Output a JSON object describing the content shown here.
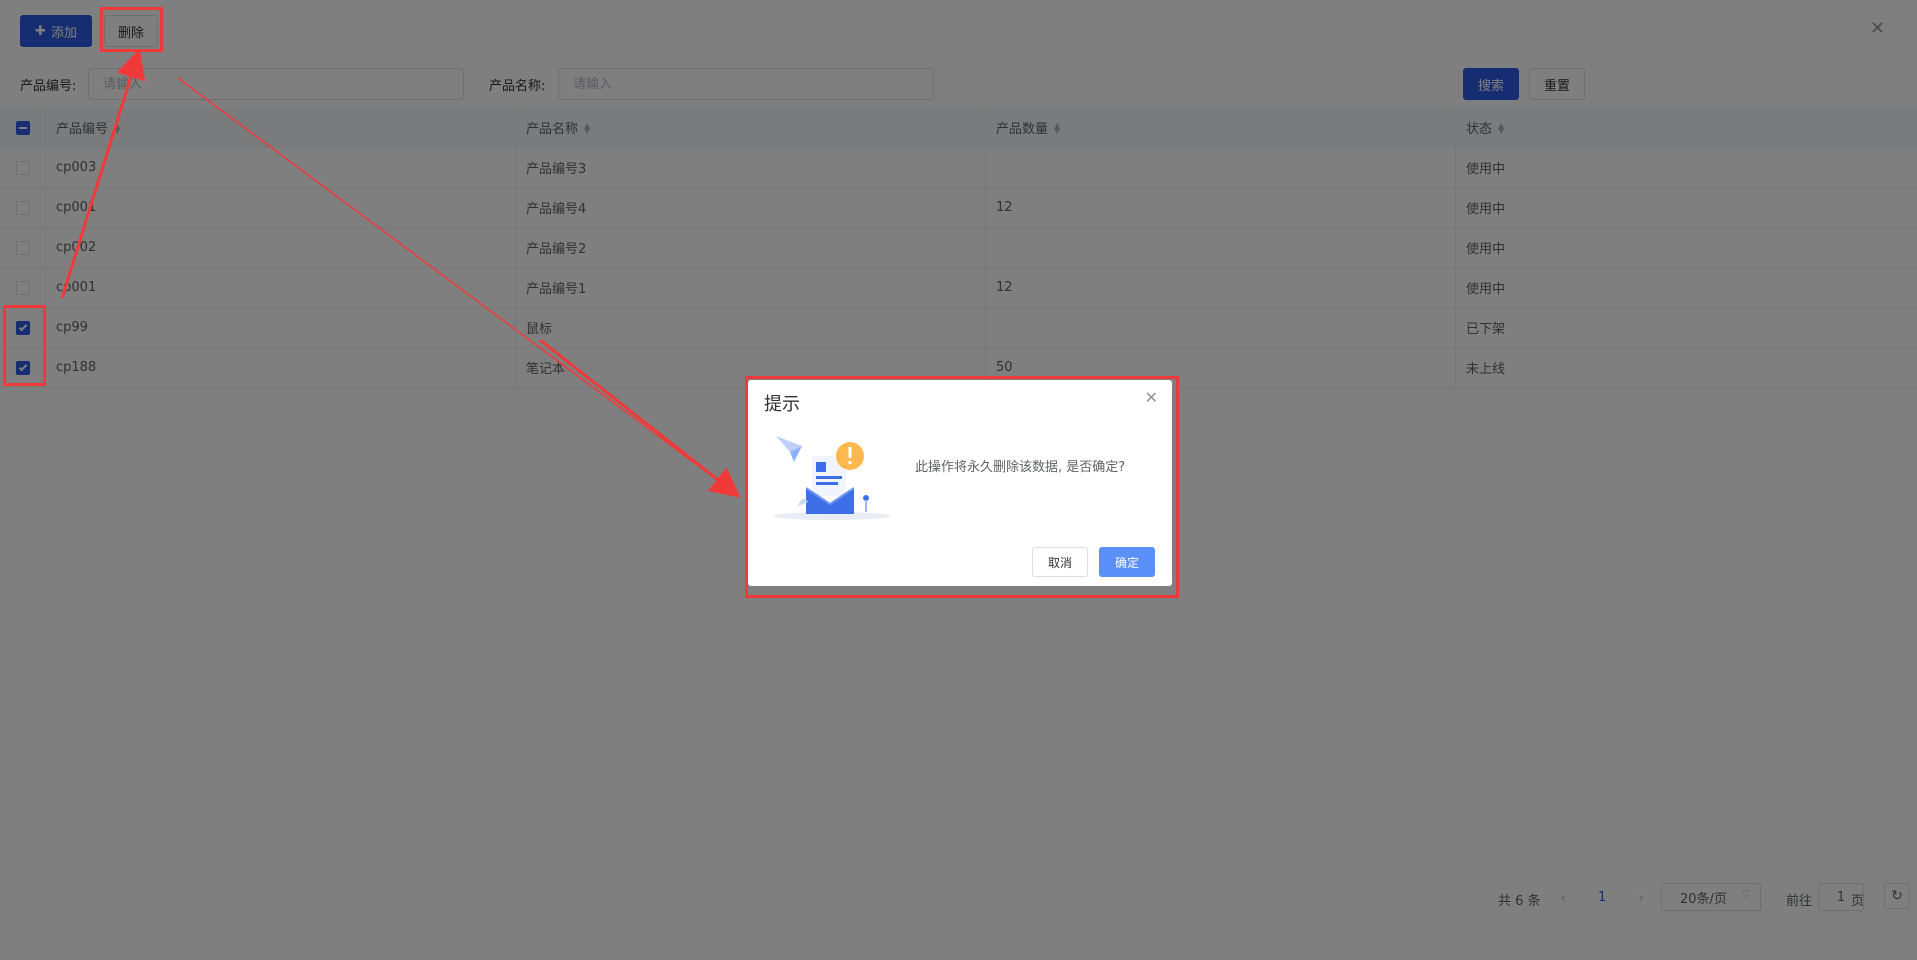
{
  "toolbar": {
    "add_label": "添加",
    "delete_label": "删除"
  },
  "filters": {
    "code_label": "产品编号:",
    "code_placeholder": "请输入",
    "name_label": "产品名称:",
    "name_placeholder": "请输入",
    "search_label": "搜索",
    "reset_label": "重置"
  },
  "table": {
    "columns": [
      "产品编号",
      "产品名称",
      "产品数量",
      "状态"
    ],
    "rows": [
      {
        "code": "cp003",
        "name": "产品编号3",
        "qty": "",
        "status": "使用中",
        "checked": false
      },
      {
        "code": "cp001",
        "name": "产品编号4",
        "qty": "12",
        "status": "使用中",
        "checked": false
      },
      {
        "code": "cp002",
        "name": "产品编号2",
        "qty": "",
        "status": "使用中",
        "checked": false
      },
      {
        "code": "cp001",
        "name": "产品编号1",
        "qty": "12",
        "status": "使用中",
        "checked": false
      },
      {
        "code": "cp99",
        "name": "鼠标",
        "qty": "",
        "status": "已下架",
        "checked": true
      },
      {
        "code": "cp188",
        "name": "笔记本",
        "qty": "50",
        "status": "未上线",
        "checked": true
      }
    ]
  },
  "pagination": {
    "total": "共 6 条",
    "current_page": "1",
    "page_size": "20条/页",
    "goto_prefix": "前往",
    "goto_value": "1",
    "goto_suffix": "页"
  },
  "dialog": {
    "title": "提示",
    "message": "此操作将永久删除该数据, 是否确定?",
    "cancel_label": "取消",
    "confirm_label": "确定"
  },
  "colors": {
    "primary": "#2d5be3",
    "annotation": "#f03a3a",
    "confirm": "#5b8ff9"
  }
}
